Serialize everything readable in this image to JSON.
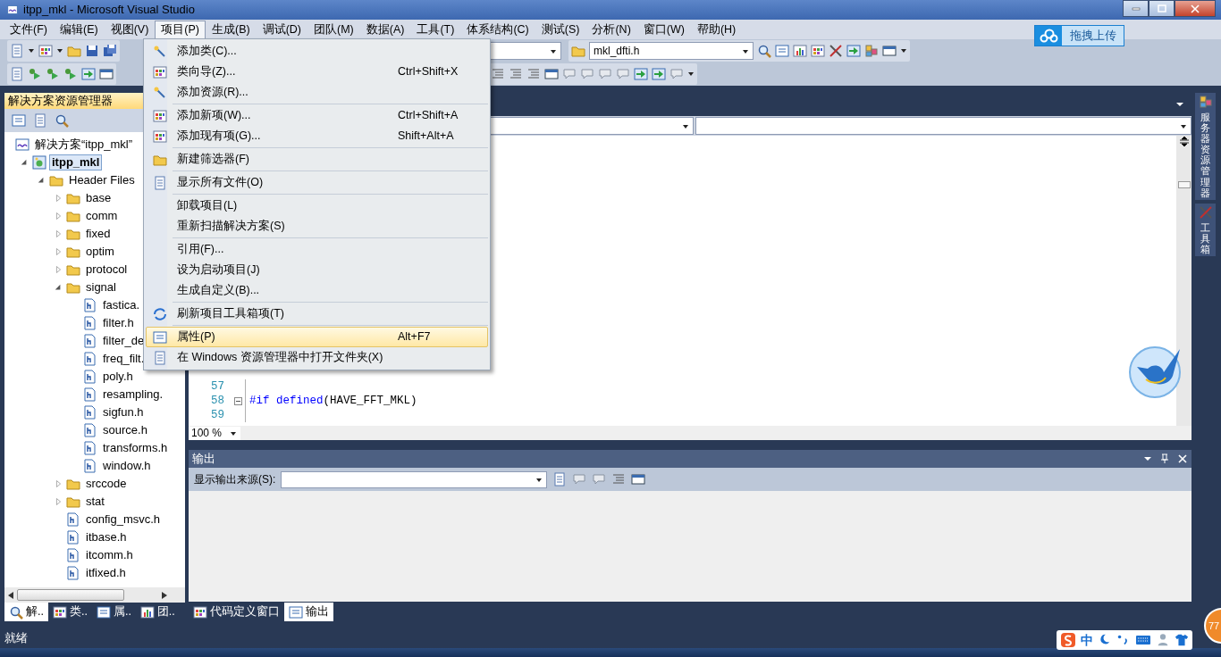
{
  "window": {
    "title": "itpp_mkl - Microsoft Visual Studio"
  },
  "menu_bar": [
    {
      "label": "文件(F)",
      "selected": false
    },
    {
      "label": "编辑(E)",
      "selected": false
    },
    {
      "label": "视图(V)",
      "selected": false
    },
    {
      "label": "项目(P)",
      "selected": true
    },
    {
      "label": "生成(B)",
      "selected": false
    },
    {
      "label": "调试(D)",
      "selected": false
    },
    {
      "label": "团队(M)",
      "selected": false
    },
    {
      "label": "数据(A)",
      "selected": false
    },
    {
      "label": "工具(T)",
      "selected": false
    },
    {
      "label": "体系结构(C)",
      "selected": false
    },
    {
      "label": "测试(S)",
      "selected": false
    },
    {
      "label": "分析(N)",
      "selected": false
    },
    {
      "label": "窗口(W)",
      "selected": false
    },
    {
      "label": "帮助(H)",
      "selected": false
    }
  ],
  "toolbar": {
    "file_combo": {
      "value": "mkl_dfti.h"
    }
  },
  "upload_button": {
    "label": "拖拽上传"
  },
  "solution_explorer": {
    "title": "解决方案资源管理器",
    "tree": [
      {
        "kind": "solution",
        "label": "解决方案“itpp_mkl”",
        "selected": false,
        "children": [
          {
            "kind": "project",
            "label": "itpp_mkl",
            "selected": true,
            "expanded": true,
            "children": [
              {
                "kind": "folder",
                "label": "Header Files",
                "selected": false,
                "expanded": true,
                "children": [
                  {
                    "kind": "folder",
                    "label": "base",
                    "selected": false,
                    "expanded": false
                  },
                  {
                    "kind": "folder",
                    "label": "comm",
                    "selected": false,
                    "expanded": false
                  },
                  {
                    "kind": "folder",
                    "label": "fixed",
                    "selected": false,
                    "expanded": false
                  },
                  {
                    "kind": "folder",
                    "label": "optim",
                    "selected": false,
                    "expanded": false
                  },
                  {
                    "kind": "folder",
                    "label": "protocol",
                    "selected": false,
                    "expanded": false
                  },
                  {
                    "kind": "folder",
                    "label": "signal",
                    "selected": false,
                    "expanded": true,
                    "children": [
                      {
                        "kind": "file",
                        "label": "fastica.",
                        "selected": false
                      },
                      {
                        "kind": "file",
                        "label": "filter.h",
                        "selected": false
                      },
                      {
                        "kind": "file",
                        "label": "filter_de",
                        "selected": false
                      },
                      {
                        "kind": "file",
                        "label": "freq_filt.",
                        "selected": false
                      },
                      {
                        "kind": "file",
                        "label": "poly.h",
                        "selected": false
                      },
                      {
                        "kind": "file",
                        "label": "resampling.",
                        "selected": false
                      },
                      {
                        "kind": "file",
                        "label": "sigfun.h",
                        "selected": false
                      },
                      {
                        "kind": "file",
                        "label": "source.h",
                        "selected": false
                      },
                      {
                        "kind": "file",
                        "label": "transforms.h",
                        "selected": false
                      },
                      {
                        "kind": "file",
                        "label": "window.h",
                        "selected": false
                      }
                    ]
                  },
                  {
                    "kind": "folder",
                    "label": "srccode",
                    "selected": false,
                    "expanded": false
                  },
                  {
                    "kind": "folder",
                    "label": "stat",
                    "selected": false,
                    "expanded": false
                  },
                  {
                    "kind": "file",
                    "label": "config_msvc.h",
                    "selected": false
                  },
                  {
                    "kind": "file",
                    "label": "itbase.h",
                    "selected": false
                  },
                  {
                    "kind": "file",
                    "label": "itcomm.h",
                    "selected": false
                  },
                  {
                    "kind": "file",
                    "label": "itfixed.h",
                    "selected": false
                  }
                ]
              }
            ]
          }
        ]
      }
    ]
  },
  "left_tabs": [
    {
      "label": "解..",
      "selected": true
    },
    {
      "label": "类..",
      "selected": false
    },
    {
      "label": "属..",
      "selected": false
    },
    {
      "label": "团..",
      "selected": false
    }
  ],
  "editor": {
    "lines": [
      {
        "number": "57",
        "foldable": false
      },
      {
        "number": "58",
        "foldable": true,
        "tokens": [
          {
            "kind": "keyword",
            "text": "#if defined"
          },
          {
            "kind": "plain",
            "text": "(HAVE_FFT_MKL)"
          }
        ]
      },
      {
        "number": "59",
        "foldable": false
      }
    ],
    "zoom": "100 %"
  },
  "output": {
    "title": "输出",
    "source_label": "显示输出来源(S):"
  },
  "bottom_tabs": [
    {
      "label": "代码定义窗口",
      "selected": false
    },
    {
      "label": "输出",
      "selected": true
    }
  ],
  "side_tabs": [
    {
      "label": "服务器资源管理器"
    },
    {
      "label": "工具箱"
    }
  ],
  "project_menu": {
    "items": [
      {
        "kind": "item",
        "label": "添加类(C)...",
        "selected": false
      },
      {
        "kind": "item",
        "label": "类向导(Z)...",
        "shortcut": "Ctrl+Shift+X",
        "selected": false
      },
      {
        "kind": "item",
        "label": "添加资源(R)...",
        "selected": false
      },
      {
        "kind": "separator"
      },
      {
        "kind": "item",
        "label": "添加新项(W)...",
        "shortcut": "Ctrl+Shift+A",
        "selected": false
      },
      {
        "kind": "item",
        "label": "添加现有项(G)...",
        "shortcut": "Shift+Alt+A",
        "selected": false
      },
      {
        "kind": "separator"
      },
      {
        "kind": "item",
        "label": "新建筛选器(F)",
        "selected": false
      },
      {
        "kind": "separator"
      },
      {
        "kind": "item",
        "label": "显示所有文件(O)",
        "selected": false
      },
      {
        "kind": "separator"
      },
      {
        "kind": "item",
        "label": "卸载项目(L)",
        "selected": false
      },
      {
        "kind": "item",
        "label": "重新扫描解决方案(S)",
        "selected": false
      },
      {
        "kind": "separator"
      },
      {
        "kind": "item",
        "label": "引用(F)...",
        "selected": false
      },
      {
        "kind": "item",
        "label": "设为启动项目(J)",
        "selected": false
      },
      {
        "kind": "item",
        "label": "生成自定义(B)...",
        "selected": false
      },
      {
        "kind": "separator"
      },
      {
        "kind": "item",
        "label": "刷新项目工具箱项(T)",
        "selected": false
      },
      {
        "kind": "separator"
      },
      {
        "kind": "item",
        "label": "属性(P)",
        "shortcut": "Alt+F7",
        "selected": true
      },
      {
        "kind": "item",
        "label": "在 Windows 资源管理器中打开文件夹(X)",
        "selected": false
      }
    ]
  },
  "status_bar": {
    "text": "就绪"
  },
  "tray": {
    "ime": "中",
    "badge": "77"
  }
}
